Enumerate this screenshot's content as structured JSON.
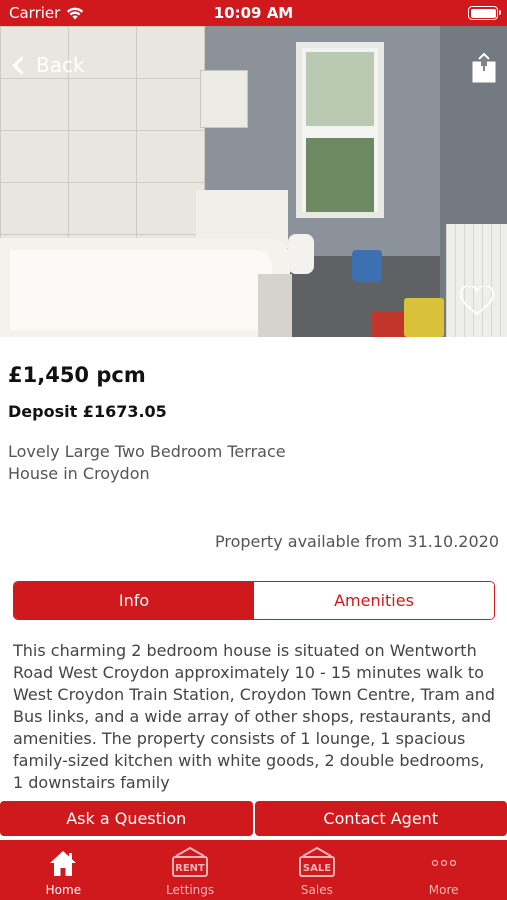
{
  "status_bar": {
    "carrier": "Carrier",
    "time": "10:09 AM"
  },
  "nav": {
    "back_label": "Back"
  },
  "listing": {
    "price": "£1,450 pcm",
    "deposit": "Deposit £1673.05",
    "title": "Lovely Large Two Bedroom Terrace House in Croydon",
    "availability": "Property available from 31.10.2020",
    "description": "This charming 2 bedroom house is situated on Wentworth Road West Croydon approximately 10 - 15 minutes walk to West Croydon Train Station, Croydon Town Centre, Tram and Bus links, and a wide array of other shops, restaurants, and amenities. The property consists of 1 lounge, 1 spacious family-sized kitchen with white goods, 2 double bedrooms, 1 downstairs family"
  },
  "tabs": [
    {
      "label": "Info",
      "active": true
    },
    {
      "label": "Amenities",
      "active": false
    }
  ],
  "actions": {
    "ask_question": "Ask a Question",
    "contact_agent": "Contact Agent"
  },
  "tab_bar": {
    "items": [
      {
        "label": "Home",
        "icon": "home-icon",
        "selected": true
      },
      {
        "label": "Lettings",
        "icon": "rent-sign-icon",
        "sign_text": "RENT",
        "selected": false
      },
      {
        "label": "Sales",
        "icon": "sale-sign-icon",
        "sign_text": "SALE",
        "selected": false
      },
      {
        "label": "More",
        "icon": "more-dots-icon",
        "selected": false
      }
    ]
  },
  "colors": {
    "brand_red": "#d0191d",
    "text_dark": "#111111",
    "text_muted": "#555555"
  }
}
